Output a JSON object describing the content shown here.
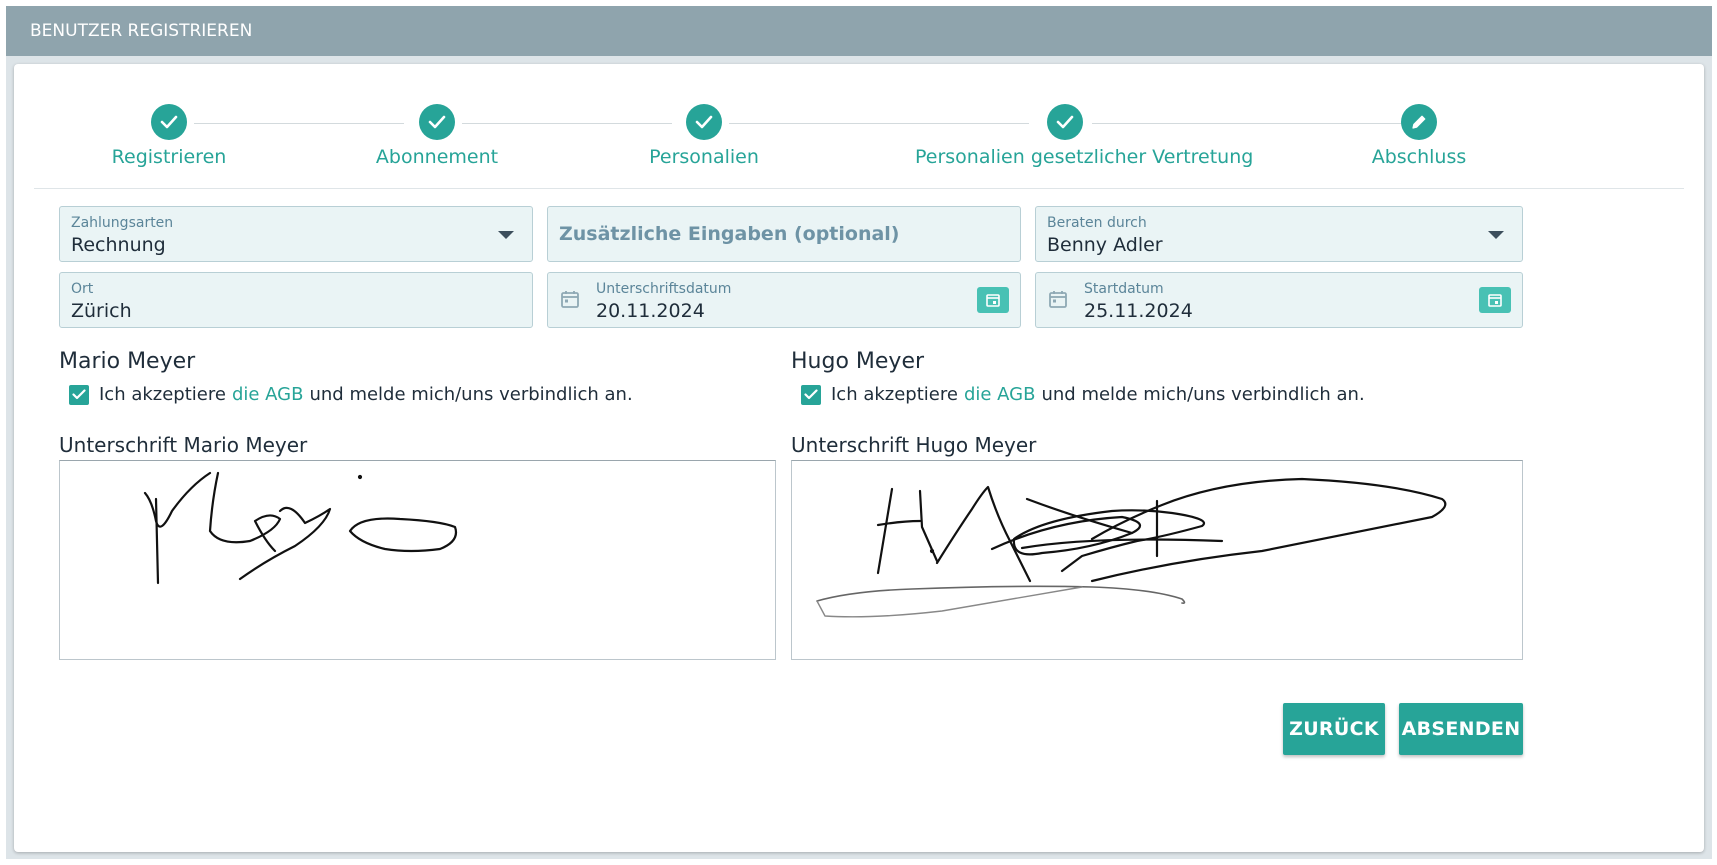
{
  "window": {
    "title": "BENUTZER REGISTRIEREN"
  },
  "stepper": {
    "steps": [
      {
        "label": "Registrieren",
        "state": "done",
        "icon": "check-icon"
      },
      {
        "label": "Abonnement",
        "state": "done",
        "icon": "check-icon"
      },
      {
        "label": "Personalien",
        "state": "done",
        "icon": "check-icon"
      },
      {
        "label": "Personalien gesetzlicher Vertretung",
        "state": "done",
        "icon": "check-icon"
      },
      {
        "label": "Abschluss",
        "state": "active",
        "icon": "pencil-icon"
      }
    ]
  },
  "form": {
    "zahlungsarten": {
      "label": "Zahlungsarten",
      "value": "Rechnung"
    },
    "zusatz": {
      "placeholder": "Zusätzliche Eingaben (optional)"
    },
    "beraten": {
      "label": "Beraten durch",
      "value": "Benny Adler"
    },
    "ort": {
      "label": "Ort",
      "value": "Zürich"
    },
    "unterschriftsdatum": {
      "label": "Unterschriftsdatum",
      "value": "20.11.2024"
    },
    "startdatum": {
      "label": "Startdatum",
      "value": "25.11.2024"
    }
  },
  "persons": [
    {
      "name": "Mario Meyer",
      "agb_prefix": "Ich akzeptiere",
      "agb_link": "die AGB",
      "agb_suffix": "und melde mich/uns verbindlich an.",
      "accepted": true,
      "signature_label": "Unterschrift Mario Meyer"
    },
    {
      "name": "Hugo Meyer",
      "agb_prefix": "Ich akzeptiere",
      "agb_link": "die AGB",
      "agb_suffix": "und melde mich/uns verbindlich an.",
      "accepted": true,
      "signature_label": "Unterschrift Hugo Meyer"
    }
  ],
  "buttons": {
    "back": "ZURÜCK",
    "submit": "ABSENDEN"
  },
  "colors": {
    "accent": "#27a498",
    "titlebar": "#8fa4ad",
    "field_bg": "#eaf4f5"
  }
}
